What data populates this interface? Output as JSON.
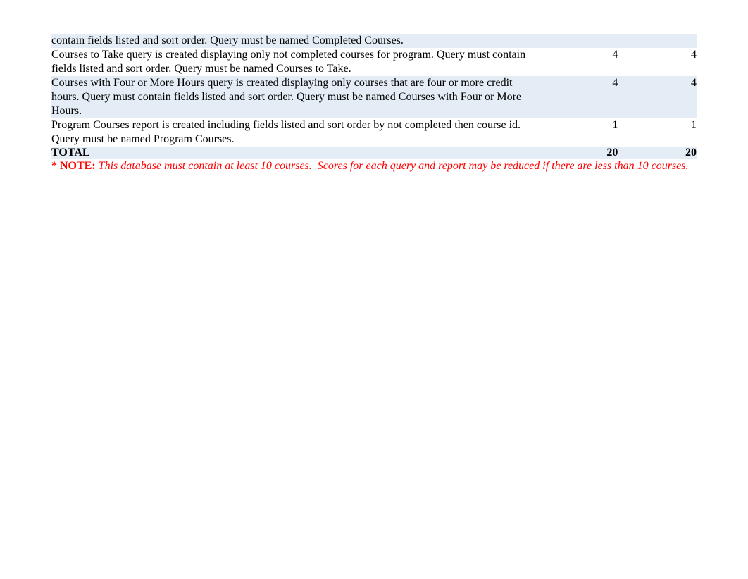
{
  "rows": [
    {
      "desc": "contain fields listed and sort order.  Query must be named Completed Courses.",
      "score1": "",
      "score2": "",
      "shaded": true
    },
    {
      "desc": "Courses to Take query is created displaying only not completed courses for program.  Query must contain fields listed and sort order.  Query must be named Courses to Take.",
      "score1": "4",
      "score2": "4",
      "shaded": false
    },
    {
      "desc": "Courses with Four or More Hours query is created displaying only courses that are four or more credit hours.  Query must contain fields listed and sort order.  Query must be named Courses with Four or More Hours.",
      "score1": "4",
      "score2": "4",
      "shaded": true
    },
    {
      "desc": "Program Courses report is created including fields listed and sort order by not completed then course id.  Query must be named Program Courses.",
      "score1": "1",
      "score2": "1",
      "shaded": false
    }
  ],
  "total": {
    "label": "TOTAL",
    "score1": "20",
    "score2": "20"
  },
  "note": {
    "label": "* NOTE:",
    "text": " This database must contain at least 10 courses.  Scores for each query and report may be reduced if there are less than 10 courses."
  }
}
